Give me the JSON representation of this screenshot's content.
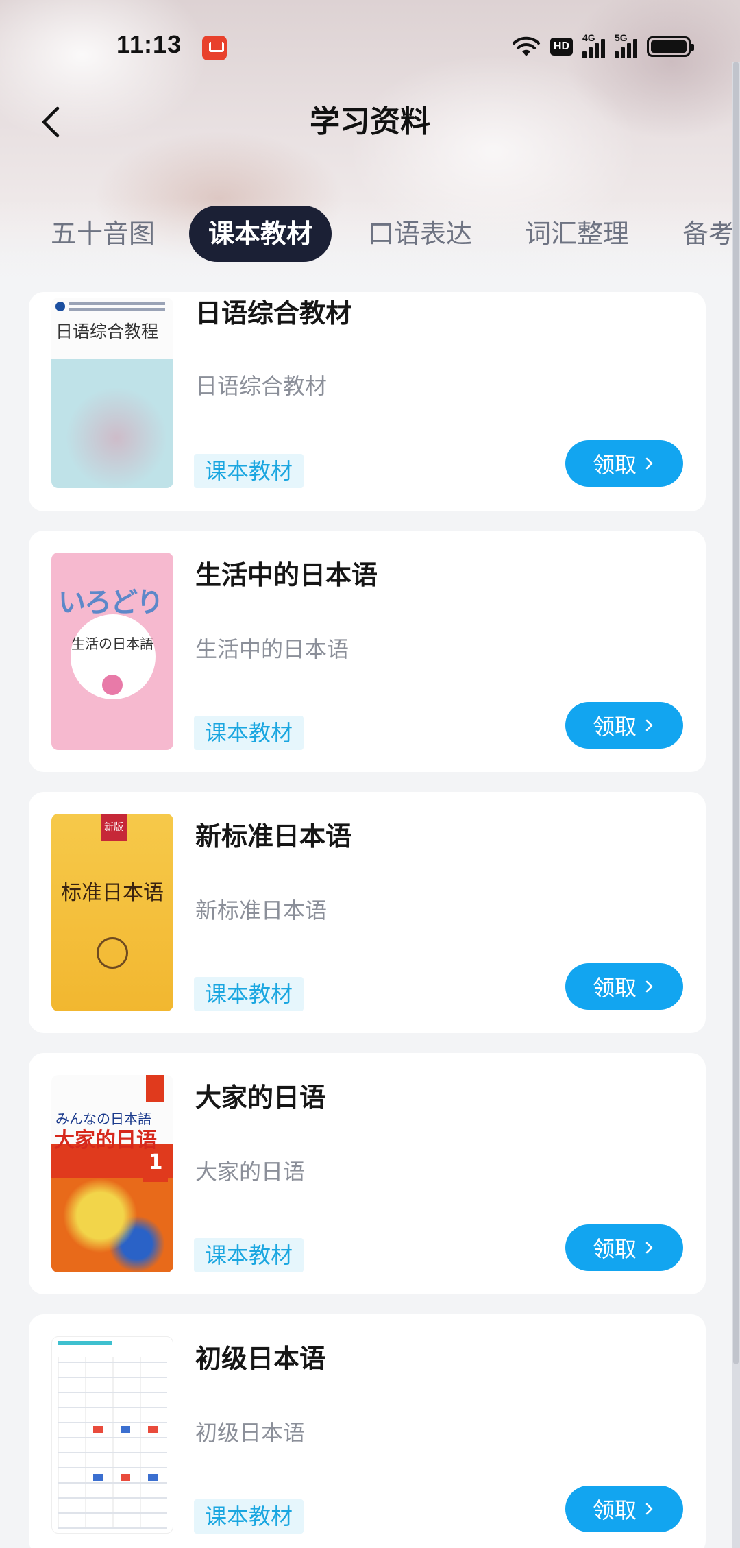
{
  "status": {
    "time": "11:13",
    "hd_label": "HD",
    "net1": "4G",
    "net2": "5G"
  },
  "nav": {
    "title": "学习资料"
  },
  "tabs": [
    {
      "label": "五十音图",
      "active": false
    },
    {
      "label": "课本教材",
      "active": true
    },
    {
      "label": "口语表达",
      "active": false
    },
    {
      "label": "词汇整理",
      "active": false
    },
    {
      "label": "备考资",
      "active": false
    }
  ],
  "items": [
    {
      "title": "日语综合教材",
      "subtitle": "日语综合教材",
      "tag": "课本教材",
      "button": "领取",
      "cover_title": "日语综合教程"
    },
    {
      "title": "生活中的日本语",
      "subtitle": "生活中的日本语",
      "tag": "课本教材",
      "button": "领取",
      "cover_title": "いろどり",
      "cover_sub": "生活の日本語"
    },
    {
      "title": "新标准日本语",
      "subtitle": "新标准日本语",
      "tag": "课本教材",
      "button": "领取",
      "cover_title": "标准日本语",
      "cover_badge": "新版"
    },
    {
      "title": "大家的日语",
      "subtitle": "大家的日语",
      "tag": "课本教材",
      "button": "领取",
      "cover_top": "みんなの日本語",
      "cover_title": "大家的日语",
      "cover_num": "1"
    },
    {
      "title": "初级日本语",
      "subtitle": "初级日本语",
      "tag": "课本教材",
      "button": "领取"
    }
  ],
  "colors": {
    "accent": "#12a5f0",
    "tag_bg": "#e6f6fc",
    "tag_text": "#1aa6e0",
    "tab_active_bg": "#1b2035"
  },
  "icons": {
    "back": "chevron-left-icon",
    "button_arrow": "chevron-right-icon"
  }
}
